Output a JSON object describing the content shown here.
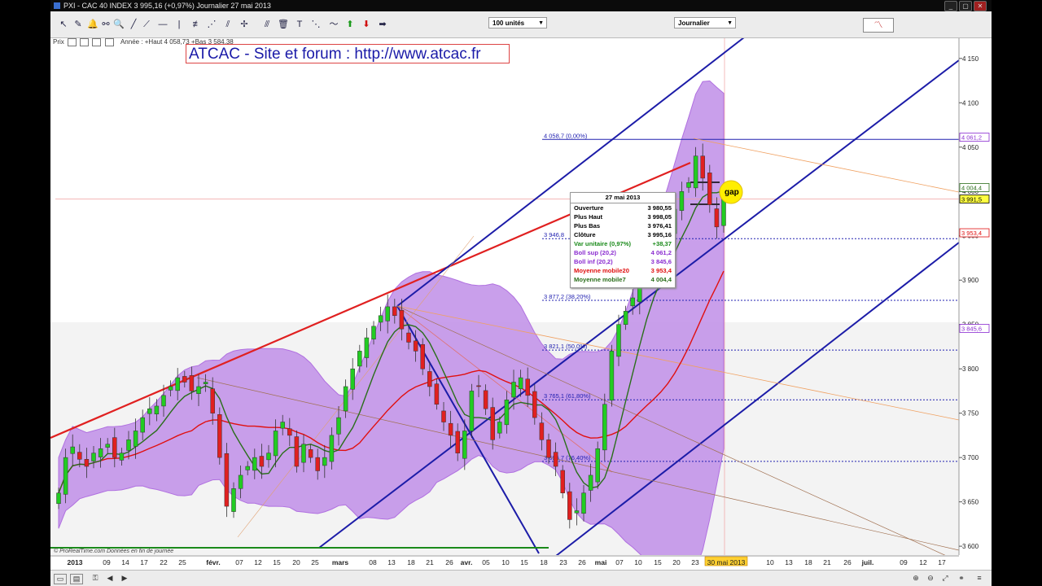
{
  "window": {
    "title": "PXI - CAC 40 INDEX    3 995,16 (+0,97%)    Journalier  27 mai 2013",
    "controls": [
      "_",
      "▢",
      "✕"
    ]
  },
  "toolbar": {
    "units_select": "100 unités",
    "period_select": "Journalier"
  },
  "top_info": {
    "label": "Prix",
    "year_range": "Année : +Haut 4 058,73  +Bas 3 584,38"
  },
  "watermark": "ATCAC - Site et forum : http://www.atcac.fr",
  "annotation": {
    "gap_label": "gap"
  },
  "footer": {
    "credit": "© ProRealTime.com  Données en fin de journée"
  },
  "info_box": {
    "date": "27 mai 2013",
    "rows": [
      {
        "label": "Ouverture",
        "value": "3 980,55",
        "color": "#000000"
      },
      {
        "label": "Plus Haut",
        "value": "3 998,05",
        "color": "#000000"
      },
      {
        "label": "Plus Bas",
        "value": "3 976,41",
        "color": "#000000"
      },
      {
        "label": "Clôture",
        "value": "3 995,16",
        "color": "#000000"
      },
      {
        "label": "Var unitaire (0,97%)",
        "value": "+38,37",
        "color": "#1a8a1a"
      },
      {
        "label": "Boll sup (20,2)",
        "value": "4 061,2",
        "color": "#8a2bd0"
      },
      {
        "label": "Boll inf (20,2)",
        "value": "3 845,6",
        "color": "#8a2bd0"
      },
      {
        "label": "Moyenne mobile20",
        "value": "3 953,4",
        "color": "#e01010"
      },
      {
        "label": "Moyenne mobile7",
        "value": "4 004,4",
        "color": "#2a6e1a"
      }
    ]
  },
  "chart_data": {
    "type": "candlestick",
    "title": "",
    "ylim": [
      3590,
      4170
    ],
    "y_ticks": [
      3600,
      3650,
      3700,
      3750,
      3800,
      3850,
      3900,
      3950,
      4000,
      4050,
      4100,
      4150
    ],
    "y_tick_labels": [
      "3 600",
      "3 650",
      "3 700",
      "3 750",
      "3 800",
      "3 850",
      "3 900",
      "3 950",
      "4 000",
      "4 050",
      "4 100",
      "4 150"
    ],
    "x_labels": [
      "2013",
      "09",
      "14",
      "17",
      "22",
      "25",
      "févr.",
      "07",
      "12",
      "15",
      "20",
      "25",
      "mars",
      "08",
      "13",
      "18",
      "21",
      "26",
      "avr.",
      "05",
      "10",
      "15",
      "18",
      "23",
      "26",
      "mai",
      "07",
      "10",
      "15",
      "20",
      "23",
      "30 mai 2013",
      "10",
      "13",
      "18",
      "21",
      "26",
      "juil.",
      "09",
      "12",
      "17"
    ],
    "closes": [
      3660,
      3700,
      3712,
      3698,
      3690,
      3705,
      3710,
      3715,
      3700,
      3705,
      3720,
      3730,
      3745,
      3755,
      3758,
      3770,
      3780,
      3790,
      3785,
      3775,
      3780,
      3785,
      3750,
      3700,
      3645,
      3665,
      3680,
      3690,
      3700,
      3690,
      3705,
      3730,
      3740,
      3725,
      3690,
      3715,
      3700,
      3685,
      3700,
      3725,
      3745,
      3780,
      3800,
      3820,
      3835,
      3848,
      3860,
      3870,
      3860,
      3845,
      3830,
      3820,
      3800,
      3780,
      3760,
      3740,
      3725,
      3705,
      3730,
      3775,
      3780,
      3755,
      3720,
      3740,
      3765,
      3785,
      3790,
      3770,
      3745,
      3720,
      3700,
      3690,
      3660,
      3630,
      3640,
      3660,
      3680,
      3710,
      3760,
      3820,
      3850,
      3865,
      3880,
      3900,
      3915,
      3930,
      3950,
      3960,
      3980,
      4000,
      4010,
      4040,
      4015,
      3985,
      3960,
      3995
    ],
    "series": [
      {
        "name": "Boll sup (20,2)",
        "last": 4061.2
      },
      {
        "name": "Boll inf (20,2)",
        "last": 3845.6
      },
      {
        "name": "Moyenne mobile20",
        "last": 3953.4
      },
      {
        "name": "Moyenne mobile7",
        "last": 4004.4
      }
    ],
    "fib_levels": [
      {
        "value": 4058.7,
        "label": "4 058,7 (0,00%)"
      },
      {
        "value": 3946.8,
        "label": "3 946,8"
      },
      {
        "value": 3877.2,
        "label": "3 877,2 (38,20%)"
      },
      {
        "value": 3821.1,
        "label": "3 821,1 (50,0%)"
      },
      {
        "value": 3765.1,
        "label": "3 765,1 (61,80%)"
      },
      {
        "value": 3695.7,
        "label": "3 695,7 (76,40%)"
      }
    ],
    "right_markers": [
      {
        "value": 4061.2,
        "label": "4 061,2",
        "color": "#8a2bd0",
        "bg": "#ffffff"
      },
      {
        "value": 4004.4,
        "label": "4 004,4",
        "color": "#2a6e1a",
        "bg": "#ffffff"
      },
      {
        "value": 3991.5,
        "label": "3 991,5",
        "color": "#000000",
        "bg": "#ffff40"
      },
      {
        "value": 3953.4,
        "label": "3 953,4",
        "color": "#e01010",
        "bg": "#ffffff"
      },
      {
        "value": 3845.6,
        "label": "3 845,6",
        "color": "#8a2bd0",
        "bg": "#ffffff"
      }
    ],
    "colors": {
      "up": "#22cc22",
      "down": "#e02020",
      "band": "#c08ee8",
      "channel": "#1c1ca8",
      "trend": "#e02020"
    }
  }
}
